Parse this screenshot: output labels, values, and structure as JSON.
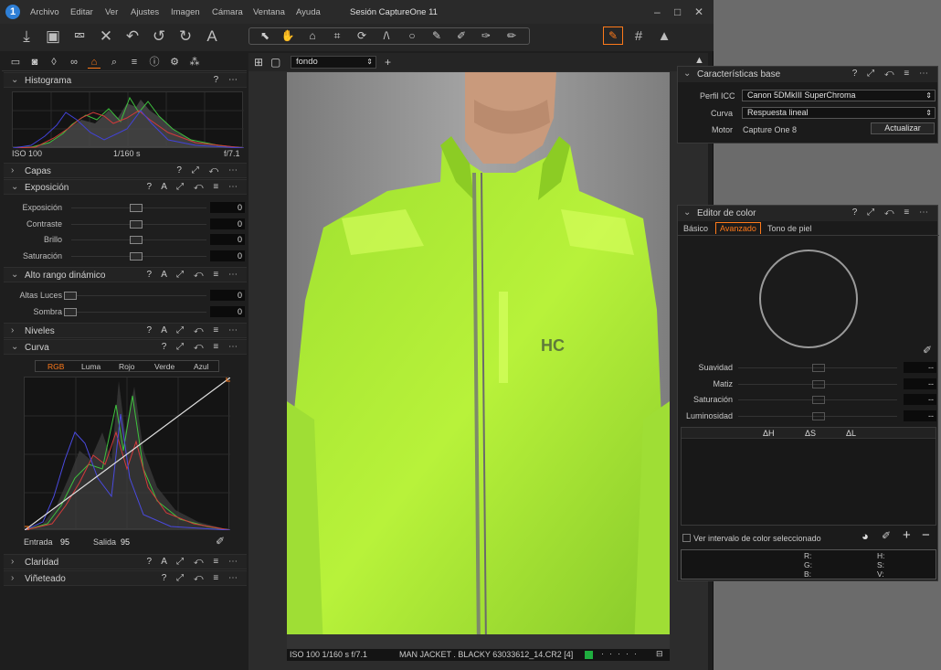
{
  "menu": [
    "Archivo",
    "Editar",
    "Ver",
    "Ajustes",
    "Imagen",
    "Cámara",
    "Ventana",
    "Ayuda"
  ],
  "window_title": "Sesión CaptureOne 11",
  "variant_selector": "fondo",
  "histogram": {
    "title": "Histograma",
    "iso": "ISO 100",
    "shutter": "1/160 s",
    "aperture": "f/7.1"
  },
  "sections": {
    "capas": "Capas",
    "exposicion": "Exposición",
    "hdr": "Alto rango dinámico",
    "niveles": "Niveles",
    "curva": "Curva",
    "claridad": "Claridad",
    "vineteado": "Viñeteado"
  },
  "exposure_rows": [
    {
      "label": "Exposición",
      "value": "0"
    },
    {
      "label": "Contraste",
      "value": "0"
    },
    {
      "label": "Brillo",
      "value": "0"
    },
    {
      "label": "Saturación",
      "value": "0"
    }
  ],
  "hdr_rows": [
    {
      "label": "Altas Luces",
      "value": "0"
    },
    {
      "label": "Sombra",
      "value": "0"
    }
  ],
  "curve_tabs": [
    "RGB",
    "Luma",
    "Rojo",
    "Verde",
    "Azul"
  ],
  "curve_io": {
    "input_label": "Entrada",
    "input_value": "95",
    "output_label": "Salida",
    "output_value": "95"
  },
  "status": {
    "exif": "ISO 100 1/160 s f/7.1",
    "filename": "MAN JACKET . BLACKY 63033612_14.CR2 [4]"
  },
  "base_characteristics": {
    "title": "Características base",
    "icc_label": "Perfil ICC",
    "icc_value": "Canon 5DMkIII SuperChroma",
    "curve_label": "Curva",
    "curve_value": "Respuesta lineal",
    "engine_label": "Motor",
    "engine_value": "Capture One 8",
    "update_button": "Actualizar"
  },
  "color_editor": {
    "title": "Editor de color",
    "tabs": [
      "Básico",
      "Avanzado",
      "Tono de piel"
    ],
    "sliders": [
      {
        "label": "Suavidad",
        "value": "--"
      },
      {
        "label": "Matiz",
        "value": "--"
      },
      {
        "label": "Saturación",
        "value": "--"
      },
      {
        "label": "Luminosidad",
        "value": "--"
      }
    ],
    "columns": [
      "ΔH",
      "ΔS",
      "ΔL"
    ],
    "checkbox_label": "Ver intervalo de color seleccionado",
    "readout_labels": [
      "R:",
      "G:",
      "B:",
      "H:",
      "S:",
      "V:"
    ]
  },
  "colors": {
    "accent": "#ff7a1a",
    "panel": "#1e1e1e",
    "jacket": "#b6f238"
  }
}
